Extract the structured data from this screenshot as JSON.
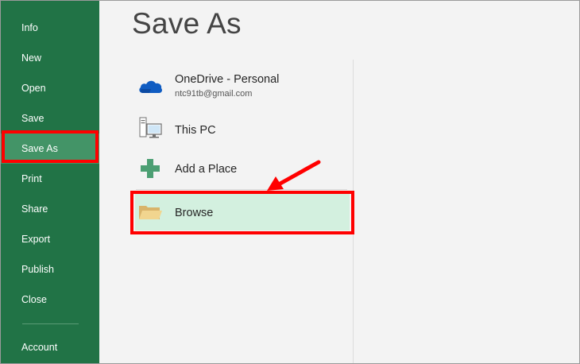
{
  "sidebar": {
    "items": [
      {
        "label": "Info"
      },
      {
        "label": "New"
      },
      {
        "label": "Open"
      },
      {
        "label": "Save"
      },
      {
        "label": "Save As",
        "selected": true
      },
      {
        "label": "Print"
      },
      {
        "label": "Share"
      },
      {
        "label": "Export"
      },
      {
        "label": "Publish"
      },
      {
        "label": "Close"
      }
    ],
    "account_label": "Account"
  },
  "main": {
    "title": "Save As",
    "locations": [
      {
        "label": "OneDrive - Personal",
        "sub": "ntc91tb@gmail.com",
        "icon": "onedrive-cloud-icon"
      },
      {
        "label": "This PC",
        "icon": "computer-icon"
      },
      {
        "label": "Add a Place",
        "icon": "plus-icon"
      },
      {
        "label": "Browse",
        "icon": "folder-icon"
      }
    ]
  },
  "colors": {
    "sidebar_bg": "#217346",
    "sidebar_selected": "#439467",
    "highlight_red": "#ff0000",
    "browse_bg": "#d3f0df",
    "onedrive_blue": "#0f5cc2",
    "add_green": "#4c9f73",
    "folder_tan": "#e8c983"
  }
}
